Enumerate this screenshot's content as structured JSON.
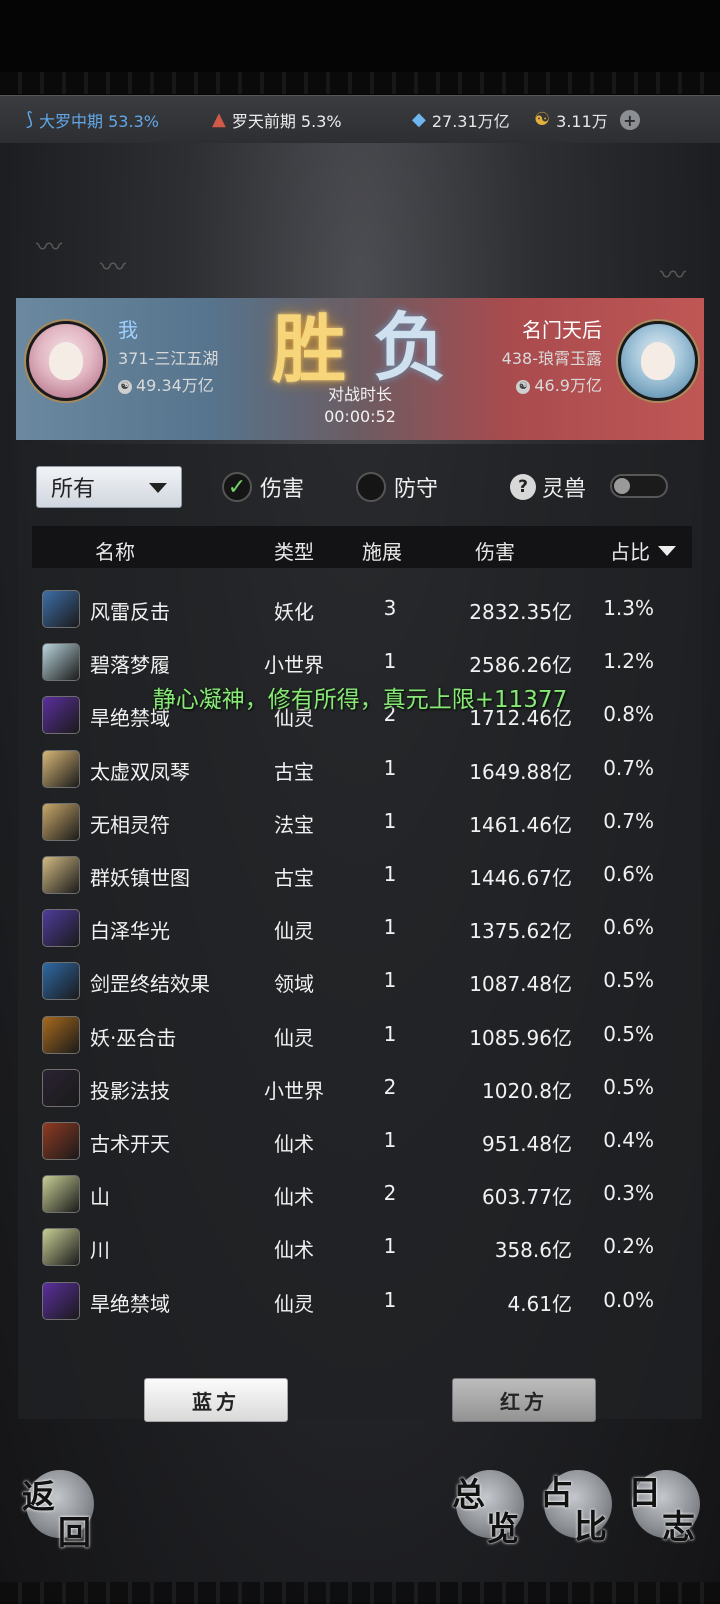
{
  "topbar": {
    "realm1": {
      "icon": "fan-icon",
      "text": "大罗中期 53.3%"
    },
    "realm2": {
      "icon": "mountain-icon",
      "text": "罗天前期 5.3%"
    },
    "spirit_stones": {
      "icon": "water-drop-icon",
      "text": "27.31万亿"
    },
    "coins": {
      "icon": "yin-yang-coin-icon",
      "text": "3.11万"
    }
  },
  "battle": {
    "me": {
      "name": "我",
      "server": "371-三江五湖",
      "power": "49.34万亿"
    },
    "opponent": {
      "name": "名门天后",
      "server": "438-琅霄玉露",
      "power": "46.9万亿"
    },
    "win_label": "胜",
    "lose_label": "负",
    "duration_label": "对战时长",
    "duration": "00:00:52"
  },
  "filters": {
    "dropdown_value": "所有",
    "damage": {
      "label": "伤害",
      "checked": true
    },
    "defense": {
      "label": "防守",
      "checked": false
    },
    "spirit_beast": {
      "label": "灵兽",
      "on": false
    }
  },
  "table": {
    "headers": {
      "name": "名称",
      "type": "类型",
      "casts": "施展",
      "damage": "伤害",
      "ratio": "占比"
    },
    "rows": [
      {
        "name": "风雷反击",
        "type": "妖化",
        "casts": "3",
        "damage": "2832.35亿",
        "ratio": "1.3%",
        "icon_color": "#3e6ea8"
      },
      {
        "name": "碧落梦履",
        "type": "小世界",
        "casts": "1",
        "damage": "2586.26亿",
        "ratio": "1.2%",
        "icon_color": "#b9d5dc"
      },
      {
        "name": "旱绝禁域",
        "type": "仙灵",
        "casts": "2",
        "damage": "1712.46亿",
        "ratio": "0.8%",
        "icon_color": "#5b2f9e"
      },
      {
        "name": "太虚双凤琴",
        "type": "古宝",
        "casts": "1",
        "damage": "1649.88亿",
        "ratio": "0.7%",
        "icon_color": "#d7b777"
      },
      {
        "name": "无相灵符",
        "type": "法宝",
        "casts": "1",
        "damage": "1461.46亿",
        "ratio": "0.7%",
        "icon_color": "#c9a869"
      },
      {
        "name": "群妖镇世图",
        "type": "古宝",
        "casts": "1",
        "damage": "1446.67亿",
        "ratio": "0.6%",
        "icon_color": "#d1ba82"
      },
      {
        "name": "白泽华光",
        "type": "仙灵",
        "casts": "1",
        "damage": "1375.62亿",
        "ratio": "0.6%",
        "icon_color": "#4f3c9c"
      },
      {
        "name": "剑罡终结效果",
        "type": "领域",
        "casts": "1",
        "damage": "1087.48亿",
        "ratio": "0.5%",
        "icon_color": "#2f69a6"
      },
      {
        "name": "妖·巫合击",
        "type": "仙灵",
        "casts": "1",
        "damage": "1085.96亿",
        "ratio": "0.5%",
        "icon_color": "#a86a1d"
      },
      {
        "name": "投影法技",
        "type": "小世界",
        "casts": "2",
        "damage": "1020.8亿",
        "ratio": "0.5%",
        "icon_color": "#2a2232"
      },
      {
        "name": "古术开天",
        "type": "仙术",
        "casts": "1",
        "damage": "951.48亿",
        "ratio": "0.4%",
        "icon_color": "#8f3a22"
      },
      {
        "name": "山",
        "type": "仙术",
        "casts": "2",
        "damage": "603.77亿",
        "ratio": "0.3%",
        "icon_color": "#c8cf95"
      },
      {
        "name": "川",
        "type": "仙术",
        "casts": "1",
        "damage": "358.6亿",
        "ratio": "0.2%",
        "icon_color": "#c8cf95"
      },
      {
        "name": "旱绝禁域",
        "type": "仙灵",
        "casts": "1",
        "damage": "4.61亿",
        "ratio": "0.0%",
        "icon_color": "#5b2f9e"
      }
    ]
  },
  "toast": "静心凝神，修有所得，真元上限+11377",
  "sides": {
    "blue": "蓝方",
    "red": "红方"
  },
  "nav": {
    "back": "返回",
    "overview": "总览",
    "ratio": "占比",
    "log": "日志"
  }
}
